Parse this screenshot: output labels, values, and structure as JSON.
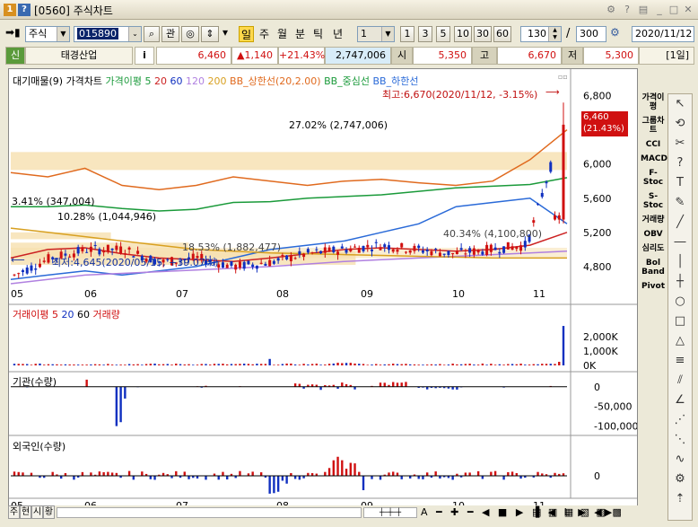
{
  "window": {
    "title": "[0560] 주식차트",
    "icon_num": "1",
    "icon_help": "?"
  },
  "toolbar": {
    "market": "주식",
    "code": "015890",
    "btn_gwan": "관",
    "periods": [
      "일",
      "주",
      "월",
      "분",
      "틱",
      "년"
    ],
    "interval_select": "1",
    "intervals": [
      "1",
      "3",
      "5",
      "10",
      "30",
      "60"
    ],
    "count": "130",
    "total": "300",
    "date": "2020/11/12"
  },
  "info": {
    "credit": "신",
    "name": "태경산업",
    "i": "i",
    "price": "6,460",
    "change": "▲1,140",
    "rate": "+21.43%",
    "volume": "2,747,006",
    "open_label": "시",
    "open": "5,350",
    "high_label": "고",
    "high": "6,670",
    "low_label": "저",
    "low": "5,300",
    "period_label": "[1일]"
  },
  "legend": {
    "vp": "대기매물(9)",
    "price": "가격차트",
    "ma": "가격이평",
    "ma5": "5",
    "ma20": "20",
    "ma60": "60",
    "ma120": "120",
    "ma200": "200",
    "bb_upper": "BB_상한선(20,2.00)",
    "bb_mid": "BB_중심선",
    "bb_lower": "BB_하한선"
  },
  "annotations": {
    "high": "최고:6,670(2020/11/12, -3.15%)",
    "low": "최저:4,645(2020/05/15, +39.07%)",
    "vp1": "27.02% (2,747,006)",
    "vp2": "3.41% (347,004)",
    "vp3": "10.28% (1,044,946)",
    "vp4": "18.53% (1,882,477)",
    "vp5": "40.34% (4,100,800)",
    "price_tag": "6,460",
    "rate_tag": "(21.43%)"
  },
  "volume_pane": {
    "title": "거래이평",
    "ma5": "5",
    "ma20": "20",
    "ma60": "60",
    "vol": "거래량"
  },
  "inst_pane": {
    "title": "기관(수량)"
  },
  "foreign_pane": {
    "title": "외국인(수량)"
  },
  "right_tools": [
    "가격이평",
    "그룹차트",
    "CCI",
    "MACD",
    "F-Stoc",
    "S-Stoc",
    "거래량",
    "OBV",
    "심리도",
    "Bol Band",
    "Pivot"
  ],
  "bottom": {
    "tabs": [
      "주",
      "현",
      "시",
      "황"
    ]
  },
  "colors": {
    "up": "#d01010",
    "down": "#1030c0",
    "bb_upper": "#e06a1e",
    "bb_mid": "#1a9a3a",
    "bb_lower": "#2a6ad8",
    "ma20": "#cc2222",
    "ma120": "#b080e0",
    "ma200": "#d8a020",
    "vp": "#f5deaa"
  },
  "chart_data": [
    {
      "type": "line",
      "title": "가격차트",
      "x": [
        "05",
        "06",
        "07",
        "08",
        "09",
        "10",
        "11"
      ],
      "ylim": [
        4400,
        6900
      ],
      "y_ticks": [
        6800,
        6000,
        5600,
        5200,
        4800
      ],
      "y_tick_labels": [
        "6,800",
        "6,000",
        "5,600",
        "5,200",
        "4,800"
      ],
      "series": [
        {
          "name": "BB_상한선(20,2.00)",
          "values": [
            5900,
            5850,
            5950,
            5750,
            5700,
            5750,
            5850,
            5800,
            5750,
            5800,
            5820,
            5780,
            5750,
            5800,
            6050,
            6400
          ]
        },
        {
          "name": "BB_중심선",
          "values": [
            5500,
            5500,
            5520,
            5480,
            5450,
            5470,
            5550,
            5560,
            5600,
            5620,
            5640,
            5680,
            5720,
            5740,
            5760,
            5840
          ]
        },
        {
          "name": "BB_하한선",
          "values": [
            4650,
            4700,
            4750,
            4700,
            4750,
            4800,
            4900,
            5000,
            5050,
            5100,
            5200,
            5300,
            5500,
            5550,
            5600,
            5300
          ]
        },
        {
          "name": "가격이평 20",
          "values": [
            4900,
            5000,
            5020,
            4950,
            4900,
            4880,
            4860,
            4900,
            4950,
            5000,
            5020,
            5000,
            4980,
            5000,
            5050,
            5200
          ]
        },
        {
          "name": "가격이평 120",
          "values": [
            4600,
            4650,
            4700,
            4720,
            4740,
            4760,
            4780,
            4800,
            4830,
            4860,
            4880,
            4900,
            4920,
            4940,
            4960,
            4980
          ]
        },
        {
          "name": "가격이평 200",
          "values": [
            5250,
            5200,
            5150,
            5100,
            5050,
            5000,
            4980,
            4960,
            4950,
            4940,
            4930,
            4920,
            4910,
            4900,
            4900,
            4900
          ]
        },
        {
          "name": "가격차트",
          "values": [
            4700,
            4900,
            5000,
            5000,
            4850,
            4900,
            4800,
            4850,
            4950,
            5000,
            5050,
            5000,
            4950,
            5000,
            5050,
            6460
          ]
        }
      ],
      "annotations": {
        "high": 6670,
        "low": 4645,
        "current": 6460
      }
    },
    {
      "type": "bar",
      "title": "거래량",
      "ylim": [
        0,
        3000000
      ],
      "y_ticks": [
        2000000,
        1000000,
        0
      ],
      "y_tick_labels": [
        "2,000K",
        "1,000K",
        "0K"
      ],
      "peak": 2747006
    },
    {
      "type": "bar",
      "title": "기관(수량)",
      "ylim": [
        -110000,
        20000
      ],
      "y_ticks": [
        0,
        -50000,
        -100000
      ],
      "y_tick_labels": [
        "0",
        "-50,000",
        "-100,000"
      ]
    },
    {
      "type": "bar",
      "title": "외국인(수량)",
      "y_ticks": [
        0
      ],
      "y_tick_labels": [
        "0"
      ]
    }
  ]
}
